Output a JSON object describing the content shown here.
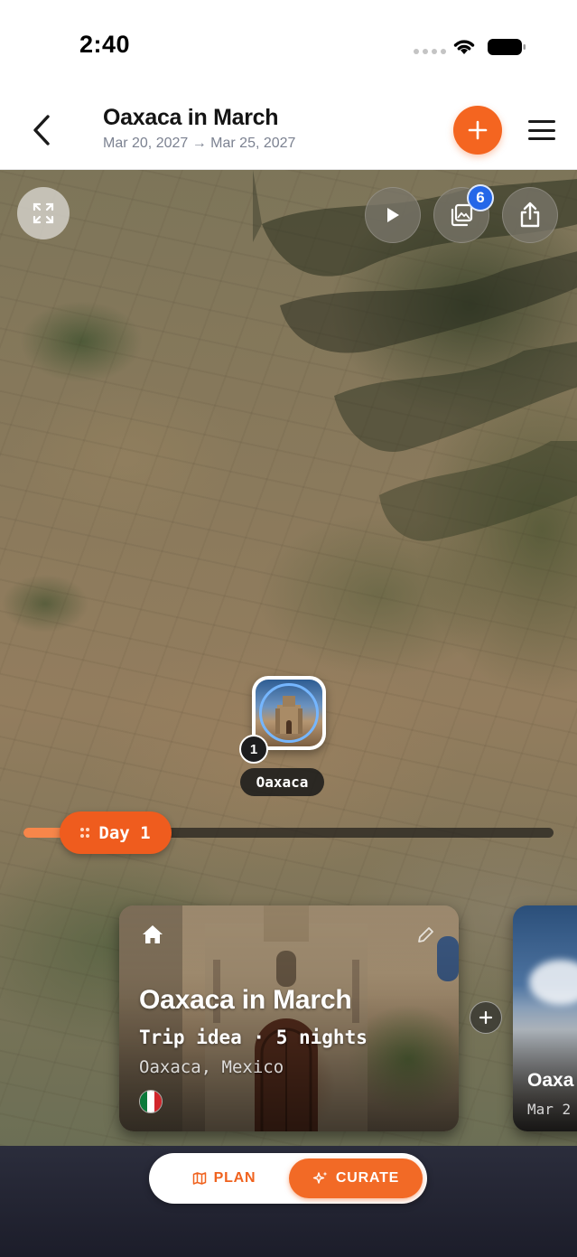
{
  "status_bar": {
    "time": "2:40"
  },
  "header": {
    "title": "Oaxaca in March",
    "dates": "Mar 20, 2027 → Mar 25, 2027",
    "add_icon": "plus-icon",
    "menu_icon": "hamburger-icon"
  },
  "map": {
    "controls": [
      "expand-icon",
      "play-icon",
      "gallery-icon",
      "share-icon"
    ],
    "gallery_count": "6",
    "marker": {
      "number": "1",
      "label": "Oaxaca"
    },
    "timeline": {
      "day_label": "Day 1",
      "progress": 0.08
    }
  },
  "cards": [
    {
      "title": "Oaxaca in March",
      "subtitle": "Trip idea · 5 nights",
      "location": "Oaxaca, Mexico",
      "flag": "mexico-flag"
    },
    {
      "title": "Oaxa",
      "date": "Mar 2"
    }
  ],
  "mode_toggle": {
    "plan_label": "PLAN",
    "curate_label": "CURATE",
    "selected": "CURATE"
  },
  "colors": {
    "accent": "#f46520",
    "badge": "#2467e8",
    "marker_ring": "#75b6ff"
  }
}
